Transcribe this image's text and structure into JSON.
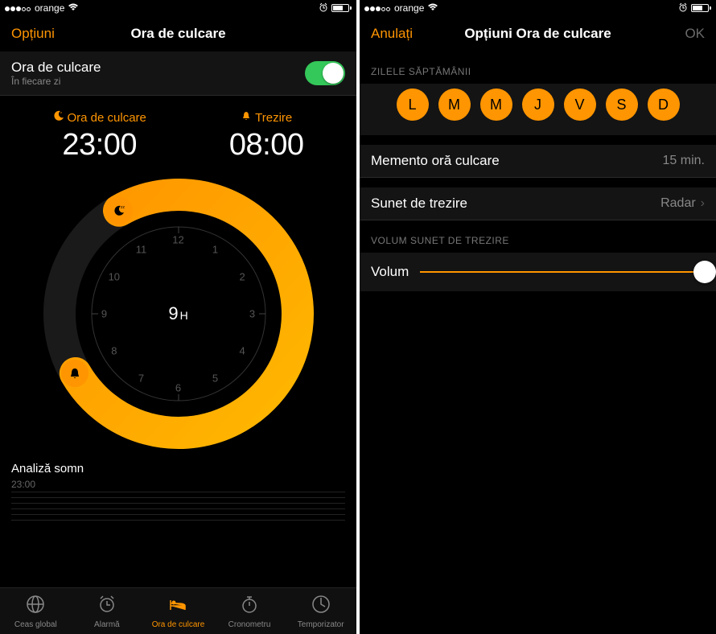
{
  "status": {
    "carrier": "orange"
  },
  "left": {
    "nav": {
      "left": "Opțiuni",
      "title": "Ora de culcare"
    },
    "bedtime_row": {
      "title": "Ora de culcare",
      "subtitle": "În fiecare zi",
      "toggle": true
    },
    "bed": {
      "label": "Ora de culcare",
      "value": "23:00"
    },
    "wake": {
      "label": "Trezire",
      "value": "08:00"
    },
    "duration": {
      "value": "9",
      "unit": "H"
    },
    "clock_hours": [
      "12",
      "1",
      "2",
      "3",
      "4",
      "5",
      "6",
      "7",
      "8",
      "9",
      "10",
      "11"
    ],
    "analysis": {
      "title": "Analiză somn",
      "time": "23:00"
    },
    "tabs": [
      {
        "label": "Ceas global",
        "icon": "globe",
        "active": false
      },
      {
        "label": "Alarmă",
        "icon": "alarm",
        "active": false
      },
      {
        "label": "Ora de culcare",
        "icon": "bed",
        "active": true
      },
      {
        "label": "Cronometru",
        "icon": "stopwatch",
        "active": false
      },
      {
        "label": "Temporizator",
        "icon": "timer",
        "active": false
      }
    ]
  },
  "right": {
    "nav": {
      "left": "Anulați",
      "title": "Opțiuni Ora de culcare",
      "right": "OK"
    },
    "section_days": "ZILELE SĂPTĂMÂNII",
    "days": [
      "L",
      "M",
      "M",
      "J",
      "V",
      "S",
      "D"
    ],
    "reminder": {
      "label": "Memento oră culcare",
      "value": "15 min."
    },
    "sound": {
      "label": "Sunet de trezire",
      "value": "Radar"
    },
    "section_volume": "VOLUM SUNET DE TREZIRE",
    "volume": {
      "label": "Volum",
      "value": 1.0
    }
  },
  "colors": {
    "accent": "#ff9500",
    "toggle_on": "#34c759"
  }
}
